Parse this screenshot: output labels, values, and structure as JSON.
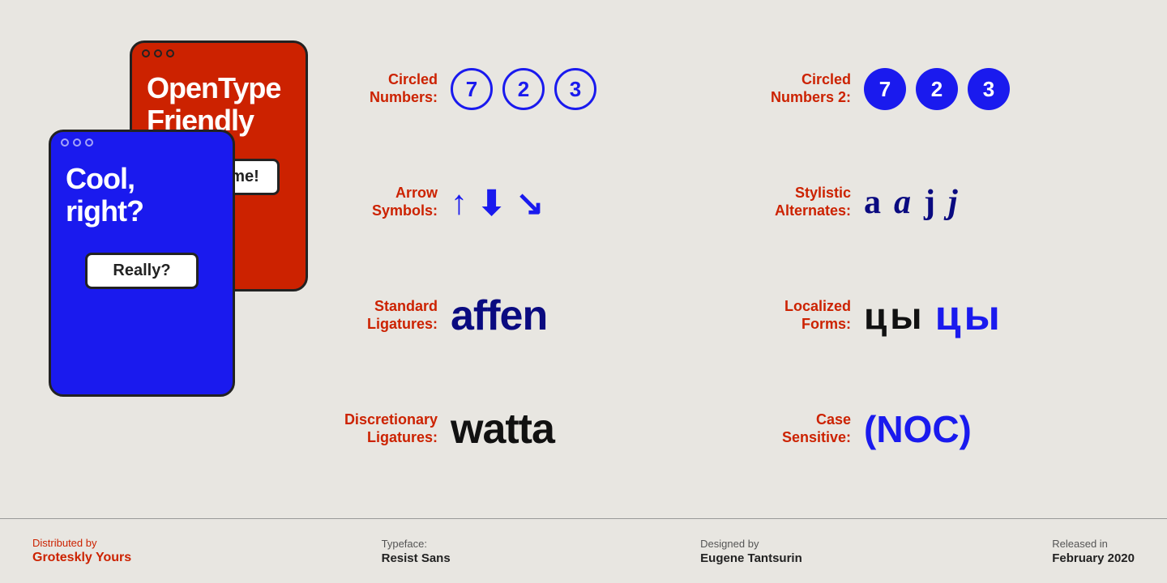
{
  "phones": {
    "back": {
      "title": "OpenType Friendly",
      "button": "Awesome!"
    },
    "front": {
      "title": "Cool, right?",
      "button": "Really?"
    }
  },
  "features": [
    {
      "label": "Circled Numbers:",
      "type": "circled-outline",
      "values": [
        "7",
        "2",
        "3"
      ]
    },
    {
      "label": "Circled Numbers 2:",
      "type": "circled-filled",
      "values": [
        "7",
        "2",
        "3"
      ]
    },
    {
      "label": "Arrow Symbols:",
      "type": "arrows",
      "values": [
        "↑",
        "⬇",
        "↘"
      ]
    },
    {
      "label": "Stylistic Alternates:",
      "type": "stylistic",
      "values": [
        "a",
        "a",
        "j",
        "j"
      ]
    },
    {
      "label": "Standard Ligatures:",
      "type": "text",
      "value": "affen"
    },
    {
      "label": "Localized Forms:",
      "type": "localized",
      "values": [
        "цы",
        "цы"
      ]
    },
    {
      "label": "Discretionary Ligatures:",
      "type": "text",
      "value": "watta"
    },
    {
      "label": "Case Sensitive:",
      "type": "text",
      "value": "(NOC)"
    }
  ],
  "footer": {
    "distributed_label": "Distributed by",
    "distributed_value": "Groteskly Yours",
    "typeface_label": "Typeface:",
    "typeface_value": "Resist Sans",
    "designed_label": "Designed by",
    "designed_value": "Eugene Tantsurin",
    "released_label": "Released in",
    "released_value": "February 2020"
  }
}
